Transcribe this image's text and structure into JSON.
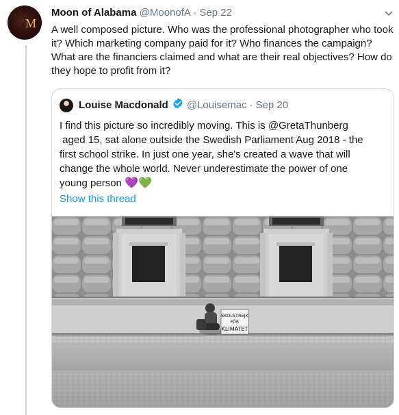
{
  "tweet": {
    "author_name": "Moon of Alabama",
    "author_handle": "@MoonofA",
    "separator": "·",
    "date": "Sep 22",
    "text": "A well composed picture. Who was the professional photographer who took it? Which marketing company paid for it? Who finances the campaign? What are the financiers claimed and what are their real objectives? How do they hope to profit from it?",
    "menu_icon": "chevron-down-icon"
  },
  "quote": {
    "author_name": "Louise Macdonald",
    "author_handle": "@Louisemac",
    "separator": "·",
    "date": "Sep 20",
    "text_line1": "I find this picture so incredibly moving. This is @GretaThunberg",
    "text_line2": " aged 15, sat alone outside the Swedish Parliament Aug 2018 - the",
    "text_line3": "first school strike. In just one year, she's created a wave that will",
    "text_line4": "change the whole world. Never underestimate the power of one",
    "text_line5": "young person",
    "hearts": [
      "💜",
      "💚"
    ],
    "show_thread": "Show this thread",
    "sign_text_line1": "SKOLSTREJK",
    "sign_text_line2": "FÖR",
    "sign_text_line3": "KLIMATET"
  },
  "colors": {
    "link": "#1b95e0",
    "muted": "#657786",
    "border": "#ccd6dd",
    "verified": "#1da1f2"
  }
}
